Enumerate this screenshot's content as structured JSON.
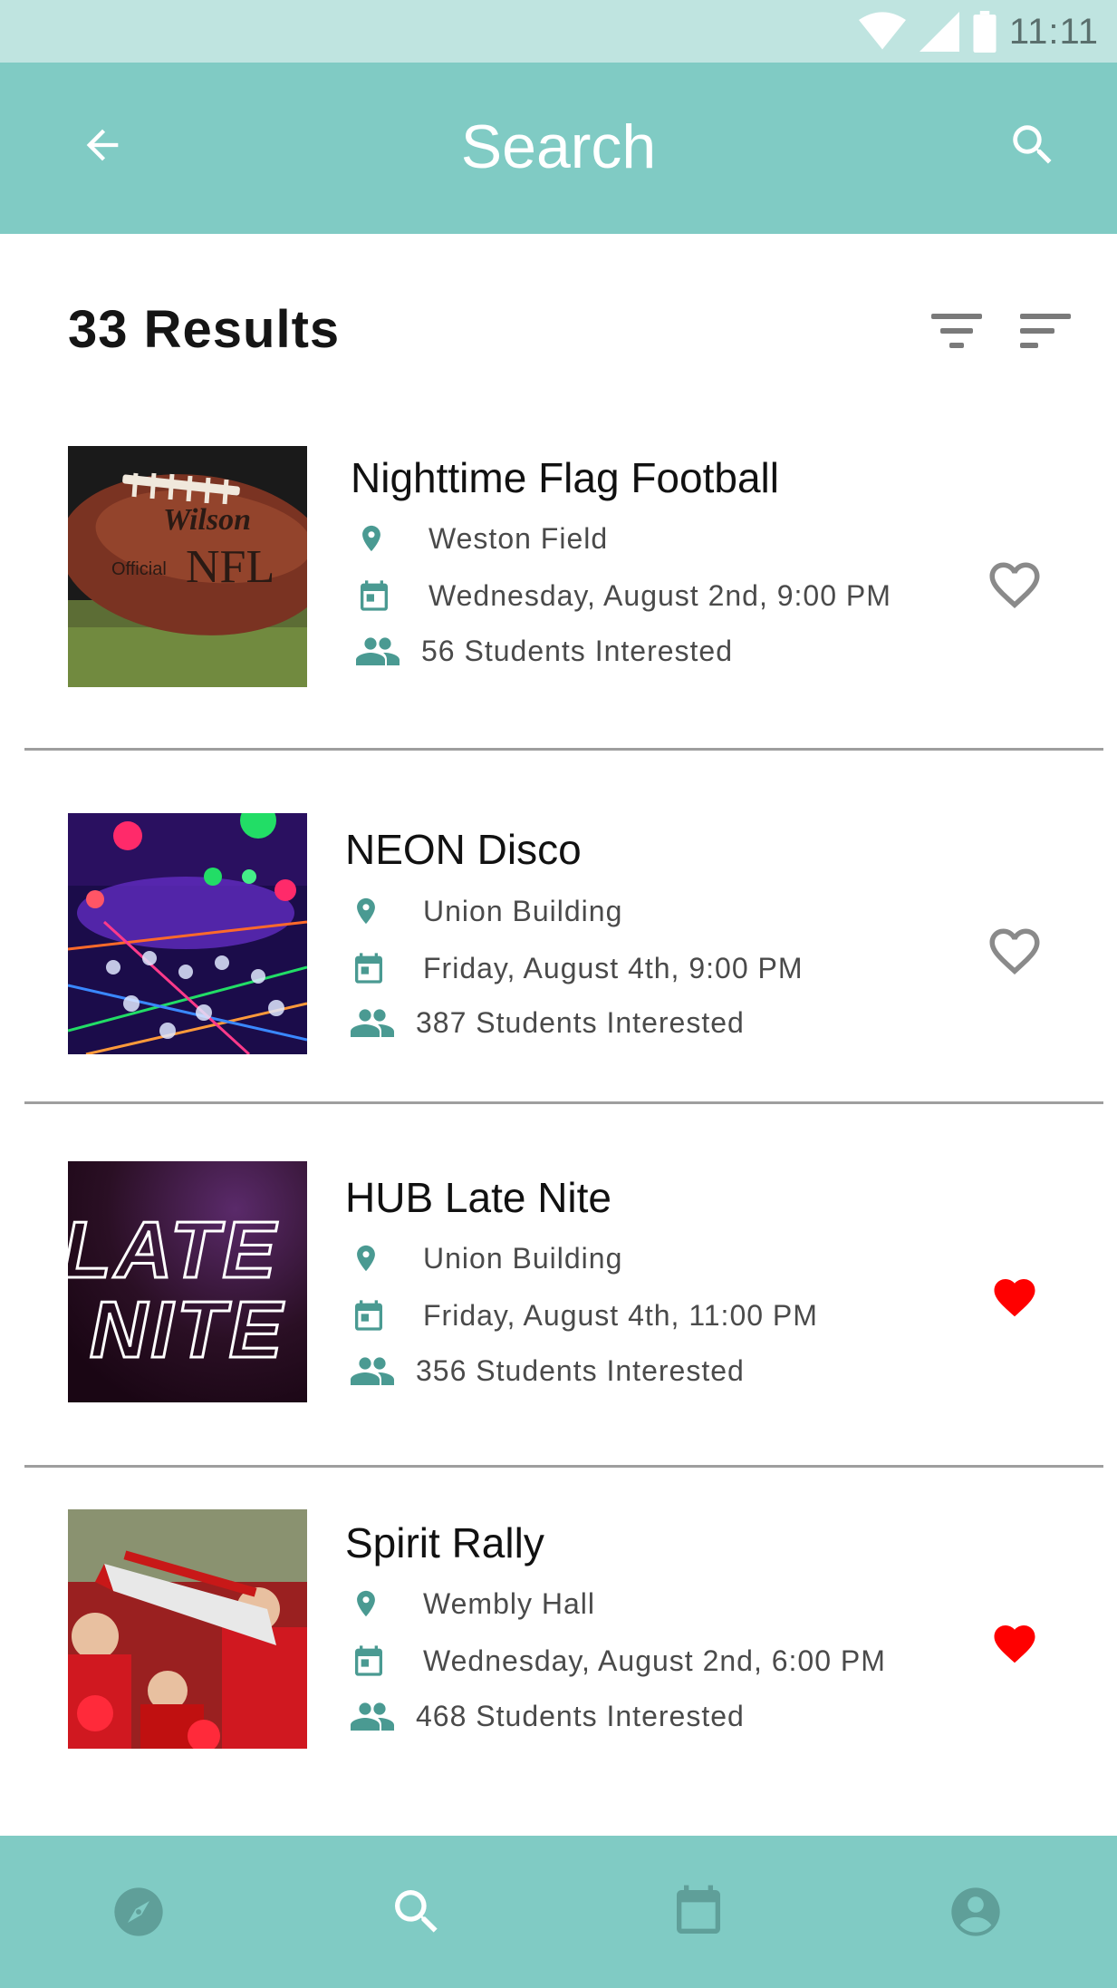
{
  "status_bar": {
    "time": "11:11"
  },
  "app_bar": {
    "title": "Search"
  },
  "results": {
    "count_label": "33 Results"
  },
  "events": [
    {
      "name": "Nighttime Flag Football",
      "location": "Weston Field",
      "date": "Wednesday, August 2nd, 9:00 PM",
      "interested": "56 Students Interested",
      "favorited": false
    },
    {
      "name": "NEON Disco",
      "location": "Union Building",
      "date": "Friday, August 4th, 9:00 PM",
      "interested": "387 Students Interested",
      "favorited": false
    },
    {
      "name": "HUB Late Nite",
      "location": "Union Building",
      "date": "Friday, August 4th, 11:00 PM",
      "interested": "356 Students Interested",
      "favorited": true
    },
    {
      "name": "Spirit Rally",
      "location": "Wembly Hall",
      "date": "Wednesday, August 2nd, 6:00 PM",
      "interested": "468 Students Interested",
      "favorited": true
    }
  ],
  "thumb_text": {
    "late_nite_line1": "LATE",
    "late_nite_line2": "NITE",
    "football_brand": "Wilson",
    "football_league": "NFL",
    "football_official": "Official"
  },
  "bottom_nav": [
    {
      "icon": "compass-icon",
      "active": false
    },
    {
      "icon": "search-icon",
      "active": true
    },
    {
      "icon": "calendar-icon",
      "active": false
    },
    {
      "icon": "account-icon",
      "active": false
    }
  ],
  "colors": {
    "primary": "#80cbc4",
    "status_bar": "#bfe4e0",
    "accent_icon": "#4a9a92",
    "favorite": "#ff0000"
  }
}
